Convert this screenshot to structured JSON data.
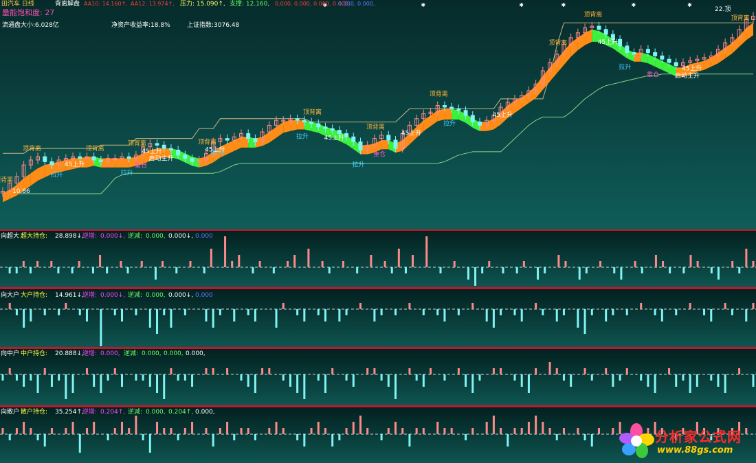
{
  "colors": {
    "bg_top": "#062a2a",
    "bg_bottom": "#0d5a57",
    "panel_divider": "#c0182a",
    "up": "#ff8a8a",
    "down": "#7ff4f4",
    "ribbon_up": "#ff8c14",
    "ribbon_down": "#3cf03c",
    "signal_pink": "#ff5ac8",
    "signal_orange": "#ffb43c",
    "signal_cyan": "#46d2ff",
    "support_line": "#8ad28a",
    "resist_line": "#c8b482"
  },
  "header": {
    "stock": "田汽车 日线",
    "indicator": "背离解盘",
    "aa10": "AA10: 14.160↑,",
    "aa12": "AA12: 13.974↑,",
    "pressure": "压力: 15.090↑,",
    "support": "支撑: 12.160,",
    "zeros": "0.000, 0.000, 0.000, 0.000,",
    "zeros_blue": "0.000, 0.000,",
    "volume_sat": "量能饱和度: 27",
    "float_cap": "流通盘大小:6.028亿",
    "roe": "净资产收益率:18.8%",
    "index": "上证指数:3076.48",
    "price_high": "22.顶",
    "price_low": "10.86"
  },
  "labels": {
    "top_div": "顶背离",
    "bottom_div": "底背离",
    "rise45": "45上升",
    "pull": "拉升",
    "build": "建仓",
    "light": "轻仓",
    "heavy": "重仓",
    "add": "建仓",
    "main_rise": "主升",
    "start_rise": "启动主升"
  },
  "panels": [
    {
      "title": "向超大",
      "name": "超大持仓:",
      "value": "28.898↓,",
      "inc": "逆增:",
      "inc_val": "0.000↓,",
      "dec": "逆减:",
      "dec_val": "0.000,",
      "extra": "0.000↓,",
      "extra2": "0.000"
    },
    {
      "title": "向大户",
      "name": "大户持仓:",
      "value": "14.961↓,",
      "inc": "逆增:",
      "inc_val": "0.000↓,",
      "dec": "逆减:",
      "dec_val": "0.000,",
      "extra": "0.000↓,",
      "extra2": "0.000"
    },
    {
      "title": "向中户",
      "name": "中户持仓:",
      "value": "20.888↓,",
      "inc": "逆增:",
      "inc_val": "0.000,",
      "dec": "逆减:",
      "dec_val": "0.000,",
      "extra": "0.000,",
      "extra2": "0.000,"
    },
    {
      "title": "向散户",
      "name": "散户持仓:",
      "value": "35.254↑,",
      "inc": "逆增:",
      "inc_val": "0.204↑,",
      "dec": "逆减:",
      "dec_val": "0.000,",
      "extra": "0.204↑,",
      "extra2": "0.000,"
    }
  ],
  "logo": {
    "name": "分析家公式网",
    "url": "www.88gs.com"
  },
  "chart_data": [
    {
      "type": "candlestick",
      "title": "背离解盘",
      "ylim": [
        10.86,
        22
      ],
      "close": [
        11.0,
        11.5,
        11.9,
        12.6,
        12.9,
        13.1,
        12.8,
        12.6,
        12.9,
        13.0,
        13.1,
        13.0,
        13.1,
        12.9,
        12.8,
        13.0,
        13.0,
        13.1,
        13.0,
        13.2,
        13.7,
        13.9,
        13.8,
        13.6,
        13.5,
        13.2,
        13.0,
        12.8,
        12.9,
        13.3,
        14.0,
        14.2,
        14.1,
        14.3,
        14.5,
        14.2,
        14.0,
        14.6,
        15.0,
        15.3,
        15.3,
        15.4,
        15.3,
        15.2,
        15.1,
        14.9,
        14.8,
        14.7,
        14.5,
        14.3,
        14.0,
        13.5,
        13.8,
        14.2,
        14.4,
        14.1,
        13.6,
        14.5,
        15.0,
        15.4,
        15.7,
        15.8,
        16.2,
        16.1,
        16.0,
        15.9,
        15.6,
        15.2,
        15.0,
        15.3,
        15.6,
        16.1,
        16.4,
        16.6,
        16.8,
        17.1,
        17.5,
        18.3,
        18.8,
        19.3,
        19.9,
        20.3,
        20.6,
        20.9,
        21.0,
        20.8,
        20.5,
        20.2,
        19.8,
        19.4,
        19.3,
        19.6,
        19.4,
        19.2,
        19.0,
        18.8,
        18.6,
        18.8,
        18.9,
        19.0,
        19.1,
        19.2,
        19.6,
        20.0,
        20.3,
        20.8,
        21.4,
        21.6
      ],
      "ribbon_upper": [
        10.9,
        11.1,
        11.4,
        11.8,
        12.1,
        12.4,
        12.6,
        12.7,
        12.8,
        12.9,
        13.0,
        13.0,
        13.1,
        13.1,
        13.0,
        13.0,
        13.0,
        13.0,
        13.0,
        13.1,
        13.3,
        13.5,
        13.6,
        13.6,
        13.6,
        13.5,
        13.3,
        13.1,
        13.0,
        13.1,
        13.4,
        13.7,
        13.9,
        14.1,
        14.3,
        14.3,
        14.2,
        14.3,
        14.6,
        14.9,
        15.2,
        15.3,
        15.3,
        15.3,
        15.2,
        15.1,
        14.9,
        14.8,
        14.6,
        14.4,
        14.1,
        13.8,
        13.8,
        13.9,
        14.1,
        14.1,
        13.9,
        14.1,
        14.5,
        14.9,
        15.3,
        15.6,
        15.9,
        16.0,
        16.0,
        15.9,
        15.7,
        15.4,
        15.2,
        15.2,
        15.4,
        15.8,
        16.2,
        16.5,
        16.7,
        17.0,
        17.4,
        18.0,
        18.5,
        19.0,
        19.5,
        20.0,
        20.3,
        20.6,
        20.8,
        20.7,
        20.5,
        20.2,
        19.9,
        19.6,
        19.4,
        19.4,
        19.3,
        19.1,
        18.9,
        18.7,
        18.5,
        18.5,
        18.7,
        18.8,
        18.9,
        19.1,
        19.4,
        19.7,
        20.0,
        20.4,
        20.9,
        21.2
      ],
      "ribbon_lower": [
        10.7,
        10.9,
        11.1,
        11.4,
        11.7,
        12.0,
        12.2,
        12.4,
        12.5,
        12.6,
        12.7,
        12.8,
        12.8,
        12.9,
        12.8,
        12.8,
        12.8,
        12.8,
        12.8,
        12.9,
        13.0,
        13.2,
        13.3,
        13.4,
        13.4,
        13.3,
        13.1,
        12.9,
        12.8,
        12.9,
        13.1,
        13.4,
        13.6,
        13.8,
        14.0,
        14.0,
        14.0,
        14.1,
        14.3,
        14.6,
        14.9,
        15.0,
        15.1,
        15.1,
        15.0,
        14.9,
        14.7,
        14.6,
        14.4,
        14.2,
        13.9,
        13.6,
        13.6,
        13.7,
        13.9,
        13.9,
        13.7,
        13.8,
        14.2,
        14.6,
        15.0,
        15.3,
        15.6,
        15.7,
        15.7,
        15.7,
        15.5,
        15.2,
        15.0,
        15.0,
        15.1,
        15.4,
        15.8,
        16.1,
        16.4,
        16.7,
        17.0,
        17.5,
        18.0,
        18.5,
        19.0,
        19.5,
        19.9,
        20.2,
        20.4,
        20.4,
        20.2,
        20.0,
        19.7,
        19.4,
        19.2,
        19.2,
        19.1,
        18.9,
        18.7,
        18.5,
        18.3,
        18.3,
        18.4,
        18.6,
        18.7,
        18.9,
        19.1,
        19.4,
        19.7,
        20.1,
        20.5,
        20.8
      ],
      "support": [
        10.86,
        10.86,
        10.86,
        10.86,
        10.86,
        10.86,
        10.86,
        10.86,
        10.86,
        10.86,
        10.86,
        10.86,
        10.86,
        10.86,
        10.86,
        11.3,
        11.8,
        12.0,
        12.1,
        12.1,
        12.1,
        12.1,
        12.1,
        12.1,
        12.1,
        12.1,
        12.1,
        12.1,
        12.1,
        12.1,
        12.1,
        12.2,
        12.4,
        12.6,
        12.7,
        12.7,
        12.7,
        12.7,
        12.7,
        12.7,
        12.7,
        12.7,
        12.7,
        12.7,
        12.7,
        12.7,
        12.7,
        12.7,
        12.7,
        12.7,
        12.7,
        12.7,
        12.7,
        12.7,
        12.7,
        12.7,
        12.7,
        12.7,
        12.7,
        12.7,
        12.7,
        12.7,
        12.7,
        12.8,
        13.0,
        13.2,
        13.3,
        13.4,
        13.4,
        13.4,
        13.4,
        13.4,
        13.8,
        14.2,
        14.6,
        15.0,
        15.3,
        15.5,
        15.5,
        15.5,
        15.5,
        15.8,
        16.2,
        16.6,
        16.9,
        17.2,
        17.4,
        17.5,
        17.6,
        17.7,
        17.8,
        17.9,
        18.0,
        18.0,
        18.1,
        18.1,
        18.1,
        18.1,
        18.1,
        18.1,
        18.1,
        18.1,
        18.1,
        18.1,
        18.1,
        18.1,
        18.1,
        18.1
      ],
      "resistance": [
        13.3,
        13.3,
        13.3,
        13.3,
        13.6,
        13.6,
        13.6,
        13.6,
        13.6,
        13.6,
        13.6,
        13.6,
        13.6,
        13.6,
        13.8,
        13.8,
        13.8,
        13.8,
        13.8,
        14.2,
        14.2,
        14.2,
        14.2,
        14.2,
        14.2,
        14.2,
        14.2,
        14.2,
        14.8,
        14.8,
        14.8,
        15.4,
        15.4,
        15.4,
        15.4,
        15.4,
        15.4,
        15.4,
        15.4,
        15.4,
        15.4,
        15.4,
        15.4,
        15.4,
        15.2,
        15.2,
        15.2,
        15.2,
        15.2,
        15.2,
        15.2,
        15.2,
        15.2,
        15.2,
        15.2,
        15.2,
        15.2,
        15.6,
        16.0,
        16.0,
        16.0,
        16.0,
        16.0,
        16.0,
        16.0,
        16.0,
        16.0,
        16.0,
        16.0,
        16.0,
        16.0,
        16.6,
        16.6,
        16.6,
        16.6,
        16.6,
        16.6,
        16.6,
        18.0,
        19.8,
        21.2,
        21.2,
        21.2,
        21.2,
        21.2,
        21.2,
        21.2,
        21.2,
        21.2,
        21.2,
        21.2,
        21.2,
        21.2,
        21.2,
        21.2,
        21.2,
        21.2,
        21.2,
        21.2,
        21.2,
        21.2,
        21.2,
        21.2,
        21.2,
        21.2,
        21.2,
        21.2,
        21.2
      ]
    },
    {
      "type": "bar",
      "title": "超大持仓",
      "values": [
        0,
        -1,
        -1,
        1,
        -1,
        1,
        0,
        1,
        -1,
        0,
        -1,
        1,
        0,
        -1,
        2,
        -1,
        0,
        1,
        -1,
        0,
        1,
        0,
        -2,
        1,
        0,
        -1,
        0,
        1,
        0,
        -1,
        3,
        0,
        5,
        1,
        2,
        0,
        -1,
        1,
        0,
        -1,
        0,
        1,
        2,
        0,
        3,
        0,
        1,
        -1,
        0,
        1,
        0,
        -1,
        0,
        2,
        0,
        1,
        -1,
        3,
        -1,
        2,
        0,
        5,
        0,
        -1,
        0,
        1,
        0,
        -2,
        -3,
        -1,
        1,
        0,
        -1,
        0,
        -1,
        1,
        0,
        -2,
        -1,
        0,
        2,
        1,
        0,
        -2,
        -1,
        0,
        1,
        0,
        -1,
        -2,
        0,
        1,
        -1,
        0,
        2,
        1,
        -1,
        0,
        -1,
        2,
        1,
        0,
        -1,
        -2,
        0,
        1,
        -1,
        3,
        1
      ]
    },
    {
      "type": "bar",
      "title": "大户持仓",
      "values": [
        0,
        1,
        -1,
        -3,
        -2,
        0,
        -1,
        0,
        -1,
        1,
        0,
        -1,
        -2,
        0,
        -6,
        0,
        -1,
        -2,
        0,
        -1,
        0,
        -3,
        -4,
        -1,
        -3,
        0,
        -1,
        0,
        0,
        -2,
        -3,
        -1,
        0,
        -2,
        0,
        -1,
        -2,
        0,
        0,
        -3,
        1,
        0,
        -1,
        -2,
        0,
        -1,
        -2,
        0,
        -2,
        -1,
        0,
        1,
        0,
        -2,
        -1,
        0,
        -1,
        0,
        1,
        0,
        -1,
        0,
        -1,
        -2,
        0,
        -1,
        0,
        1,
        0,
        -2,
        -3,
        -1,
        0,
        -1,
        -2,
        0,
        1,
        -1,
        0,
        -2,
        -1,
        0,
        -3,
        -4,
        -1,
        0,
        -2,
        -1,
        0,
        -1,
        0,
        1,
        0,
        -1,
        -2,
        0,
        -1,
        0,
        1,
        0,
        -1,
        -2,
        0,
        1,
        -1,
        0,
        -2,
        1
      ]
    },
    {
      "type": "bar",
      "title": "中户持仓",
      "values": [
        -1,
        1,
        -1,
        -2,
        -1,
        -3,
        1,
        -2,
        -1,
        -4,
        -3,
        0,
        1,
        -2,
        -3,
        -1,
        1,
        -2,
        0,
        -1,
        -1,
        -2,
        -3,
        -4,
        1,
        -1,
        -1,
        -2,
        0,
        1,
        1,
        0,
        1,
        0,
        -1,
        -2,
        -3,
        1,
        1,
        0,
        -1,
        -2,
        -3,
        -4,
        0,
        -1,
        -3,
        1,
        0,
        -1,
        -2,
        0,
        1,
        1,
        -1,
        -2,
        -4,
        0,
        1,
        -1,
        -2,
        1,
        0,
        -1,
        0,
        1,
        -2,
        -3,
        -1,
        0,
        1,
        1,
        0,
        -1,
        -2,
        -3,
        1,
        0,
        2,
        1,
        -1,
        -2,
        0,
        1,
        -1,
        0,
        1,
        -2,
        -1,
        1,
        0,
        -1,
        -2,
        -3,
        0,
        1,
        -2,
        -1,
        -3,
        -2,
        0,
        -1,
        -2,
        -3,
        0,
        1,
        0,
        -2
      ]
    },
    {
      "type": "bar",
      "title": "散户持仓",
      "values": [
        1,
        -1,
        1,
        2,
        1,
        -1,
        -2,
        1,
        0,
        1,
        2,
        -3,
        1,
        2,
        0,
        -1,
        1,
        2,
        1,
        3,
        -1,
        -3,
        2,
        1,
        1,
        -1,
        1,
        2,
        0,
        1,
        -2,
        1,
        2,
        -1,
        1,
        1,
        -1,
        0,
        1,
        2,
        1,
        0,
        -1,
        -2,
        1,
        2,
        1,
        -2,
        -1,
        1,
        2,
        3,
        1,
        0,
        -1,
        1,
        2,
        1,
        -2,
        1,
        1,
        0,
        2,
        1,
        1,
        0,
        -1,
        1,
        0,
        2,
        3,
        1,
        -2,
        1,
        1,
        2,
        3,
        2,
        1,
        -1,
        1,
        0,
        1,
        -1,
        -2,
        1,
        0,
        1,
        2,
        -1,
        1,
        0,
        1,
        2,
        1,
        0,
        -1,
        1,
        0,
        2,
        1,
        -1,
        1,
        0,
        1,
        2,
        1,
        0
      ]
    }
  ]
}
